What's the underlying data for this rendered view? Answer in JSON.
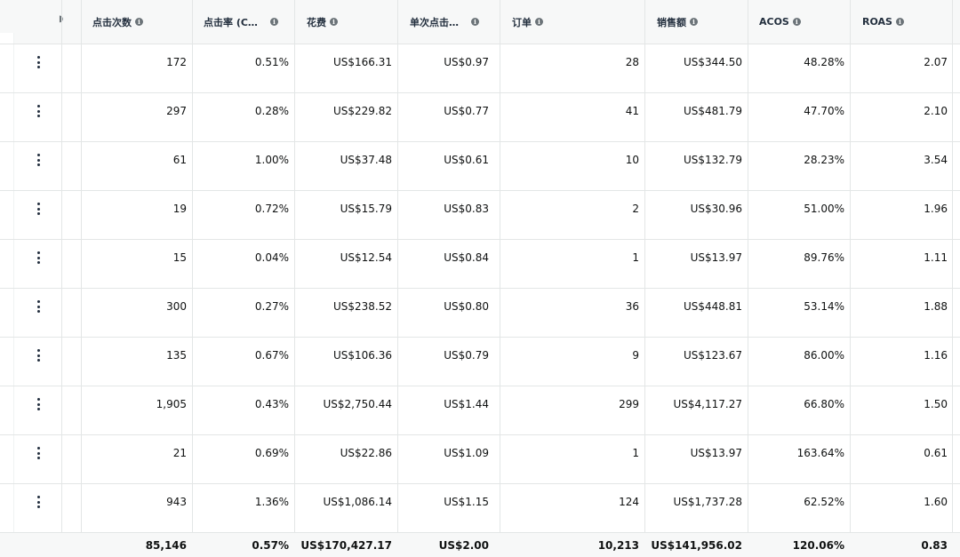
{
  "columns": [
    {
      "label": "点击次数",
      "info": "i"
    },
    {
      "label": "点击率 (C…",
      "info": "i"
    },
    {
      "label": "花费",
      "info": "i"
    },
    {
      "label": "单次点击…",
      "info": "i"
    },
    {
      "label": "订单",
      "info": "i"
    },
    {
      "label": "销售额",
      "info": "i"
    },
    {
      "label": "ACOS",
      "info": "i"
    },
    {
      "label": "ROAS",
      "info": "i"
    }
  ],
  "rows": [
    {
      "clicks": "172",
      "ctr": "0.51%",
      "spend": "US$166.31",
      "cpc": "US$0.97",
      "orders": "28",
      "sales": "US$344.50",
      "acos": "48.28%",
      "roas": "2.07"
    },
    {
      "clicks": "297",
      "ctr": "0.28%",
      "spend": "US$229.82",
      "cpc": "US$0.77",
      "orders": "41",
      "sales": "US$481.79",
      "acos": "47.70%",
      "roas": "2.10"
    },
    {
      "clicks": "61",
      "ctr": "1.00%",
      "spend": "US$37.48",
      "cpc": "US$0.61",
      "orders": "10",
      "sales": "US$132.79",
      "acos": "28.23%",
      "roas": "3.54"
    },
    {
      "clicks": "19",
      "ctr": "0.72%",
      "spend": "US$15.79",
      "cpc": "US$0.83",
      "orders": "2",
      "sales": "US$30.96",
      "acos": "51.00%",
      "roas": "1.96"
    },
    {
      "clicks": "15",
      "ctr": "0.04%",
      "spend": "US$12.54",
      "cpc": "US$0.84",
      "orders": "1",
      "sales": "US$13.97",
      "acos": "89.76%",
      "roas": "1.11"
    },
    {
      "clicks": "300",
      "ctr": "0.27%",
      "spend": "US$238.52",
      "cpc": "US$0.80",
      "orders": "36",
      "sales": "US$448.81",
      "acos": "53.14%",
      "roas": "1.88"
    },
    {
      "clicks": "135",
      "ctr": "0.67%",
      "spend": "US$106.36",
      "cpc": "US$0.79",
      "orders": "9",
      "sales": "US$123.67",
      "acos": "86.00%",
      "roas": "1.16"
    },
    {
      "clicks": "1,905",
      "ctr": "0.43%",
      "spend": "US$2,750.44",
      "cpc": "US$1.44",
      "orders": "299",
      "sales": "US$4,117.27",
      "acos": "66.80%",
      "roas": "1.50"
    },
    {
      "clicks": "21",
      "ctr": "0.69%",
      "spend": "US$22.86",
      "cpc": "US$1.09",
      "orders": "1",
      "sales": "US$13.97",
      "acos": "163.64%",
      "roas": "0.61"
    },
    {
      "clicks": "943",
      "ctr": "1.36%",
      "spend": "US$1,086.14",
      "cpc": "US$1.15",
      "orders": "124",
      "sales": "US$1,737.28",
      "acos": "62.52%",
      "roas": "1.60"
    }
  ],
  "totals": {
    "clicks": "85,146",
    "ctr": "0.57%",
    "spend": "US$170,427.17",
    "cpc": "US$2.00",
    "orders": "10,213",
    "sales": "US$141,956.02",
    "acos": "120.06%",
    "roas": "0.83"
  }
}
